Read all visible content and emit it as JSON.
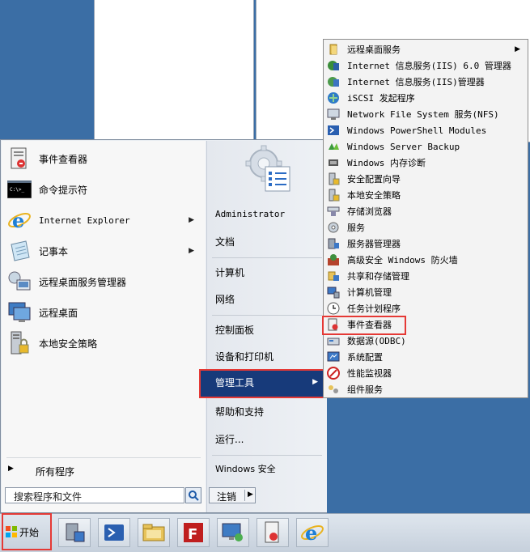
{
  "start_menu": {
    "programs": [
      {
        "label": "事件查看器",
        "icon": "event-viewer-icon"
      },
      {
        "label": "命令提示符",
        "icon": "command-prompt-icon"
      },
      {
        "label": "Internet Explorer",
        "icon": "ie-icon",
        "has_submenu": true
      },
      {
        "label": "记事本",
        "icon": "notepad-icon",
        "has_submenu": true
      },
      {
        "label": "远程桌面服务管理器",
        "icon": "rds-manager-icon"
      },
      {
        "label": "远程桌面",
        "icon": "remote-desktop-icon"
      },
      {
        "label": "本地安全策略",
        "icon": "local-security-policy-icon"
      }
    ],
    "all_programs": "所有程序",
    "search_placeholder": "搜索程序和文件",
    "right_links": {
      "user": "Administrator",
      "documents": "文档",
      "computer": "计算机",
      "network": "网络",
      "control_panel": "控制面板",
      "devices": "设备和打印机",
      "admin_tools": "管理工具",
      "help": "帮助和支持",
      "run": "运行...",
      "windows_security": "Windows 安全"
    },
    "logoff": "注销"
  },
  "admin_submenu": [
    {
      "label": "远程桌面服务",
      "icon": "folder-icon",
      "has_submenu": true
    },
    {
      "label": "Internet 信息服务(IIS) 6.0 管理器",
      "icon": "iis6-icon"
    },
    {
      "label": "Internet 信息服务(IIS)管理器",
      "icon": "iis-icon"
    },
    {
      "label": "iSCSI 发起程序",
      "icon": "iscsi-icon"
    },
    {
      "label": "Network File System 服务(NFS)",
      "icon": "nfs-icon"
    },
    {
      "label": "Windows PowerShell Modules",
      "icon": "powershell-icon"
    },
    {
      "label": "Windows Server Backup",
      "icon": "backup-icon"
    },
    {
      "label": "Windows 内存诊断",
      "icon": "memory-icon"
    },
    {
      "label": "安全配置向导",
      "icon": "security-wizard-icon"
    },
    {
      "label": "本地安全策略",
      "icon": "local-policy-icon"
    },
    {
      "label": "存储浏览器",
      "icon": "storage-icon"
    },
    {
      "label": "服务",
      "icon": "services-icon"
    },
    {
      "label": "服务器管理器",
      "icon": "server-manager-icon"
    },
    {
      "label": "高级安全 Windows 防火墙",
      "icon": "firewall-icon"
    },
    {
      "label": "共享和存储管理",
      "icon": "share-icon"
    },
    {
      "label": "计算机管理",
      "icon": "computer-mgmt-icon"
    },
    {
      "label": "任务计划程序",
      "icon": "clock-icon"
    },
    {
      "label": "事件查看器",
      "icon": "event-viewer-icon"
    },
    {
      "label": "数据源(ODBC)",
      "icon": "odbc-icon"
    },
    {
      "label": "系统配置",
      "icon": "msconfig-icon"
    },
    {
      "label": "性能监视器",
      "icon": "perfmon-icon"
    },
    {
      "label": "组件服务",
      "icon": "component-icon"
    }
  ],
  "taskbar": {
    "start_label": "开始",
    "buttons": [
      "server-manager-icon",
      "powershell-icon",
      "explorer-folder-icon",
      "filezilla-icon",
      "remote-desktop-icon",
      "event-viewer-icon",
      "ie-icon"
    ]
  },
  "colors": {
    "highlight": "#173a7a",
    "annotation_red": "#e53935"
  }
}
